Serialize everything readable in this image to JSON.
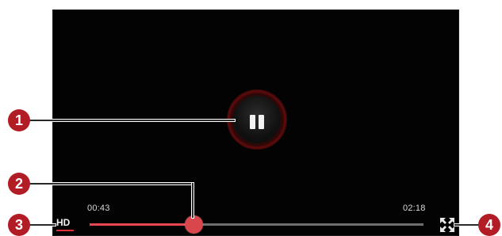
{
  "player": {
    "current_time": "00:43",
    "total_time": "02:18",
    "quality_label": "HD",
    "progress_fraction": 0.31,
    "state": "playing",
    "icons": {
      "play_pause": "pause-icon",
      "fullscreen": "fullscreen-icon"
    }
  },
  "callouts": [
    "1",
    "2",
    "3",
    "4"
  ],
  "colors": {
    "accent": "#e64750",
    "callout": "#b21c24",
    "track": "#6e6e6e",
    "background": "#030303"
  }
}
